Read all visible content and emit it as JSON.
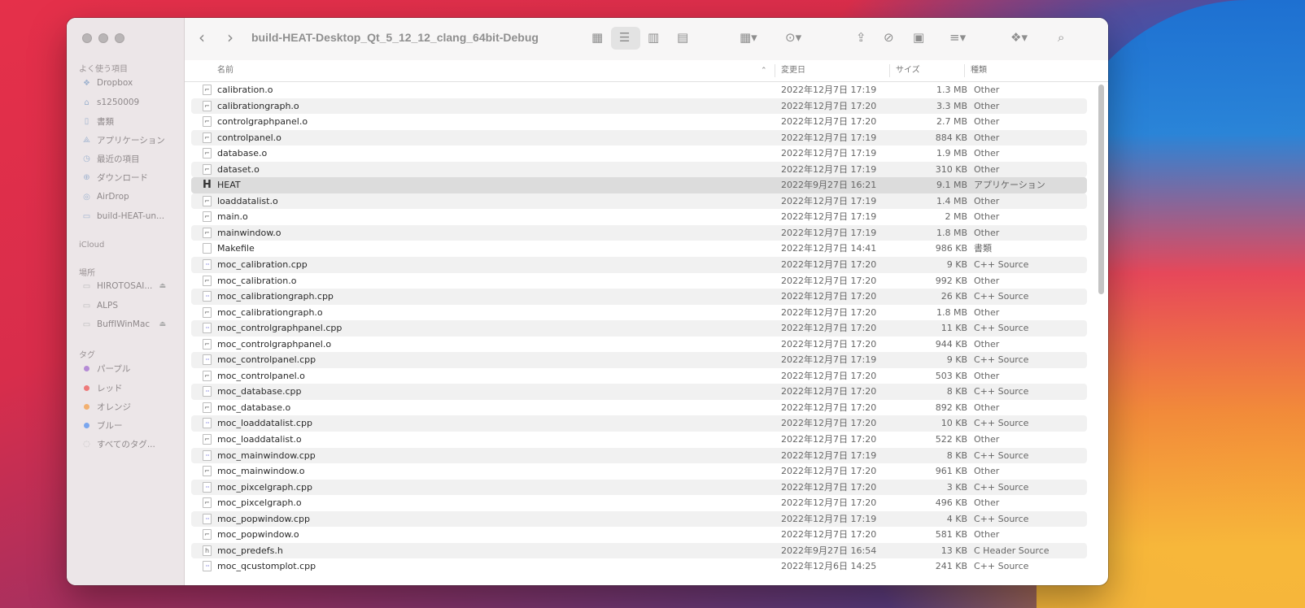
{
  "window": {
    "title": "build-HEAT-Desktop_Qt_5_12_12_clang_64bit-Debug"
  },
  "sidebar": {
    "favorites_heading": "よく使う項目",
    "favorites": [
      {
        "label": "Dropbox",
        "icon": "dropbox-icon"
      },
      {
        "label": "s1250009",
        "icon": "home-icon"
      },
      {
        "label": "書類",
        "icon": "document-icon"
      },
      {
        "label": "アプリケーション",
        "icon": "applications-icon"
      },
      {
        "label": "最近の項目",
        "icon": "clock-icon"
      },
      {
        "label": "ダウンロード",
        "icon": "download-icon"
      },
      {
        "label": "AirDrop",
        "icon": "airdrop-icon"
      },
      {
        "label": "build-HEAT-un...",
        "icon": "folder-icon"
      }
    ],
    "icloud_heading": "iCloud",
    "locations_heading": "場所",
    "locations": [
      {
        "label": "HIROTOSAI...",
        "icon": "drive-icon"
      },
      {
        "label": "ALPS",
        "icon": "drive-icon"
      },
      {
        "label": "BuffIWinMac",
        "icon": "drive-icon"
      }
    ],
    "tags_heading": "タグ",
    "tags": [
      {
        "label": "パープル",
        "color": "#b58bd6"
      },
      {
        "label": "レッド",
        "color": "#ee7a7a"
      },
      {
        "label": "オレンジ",
        "color": "#f2b070"
      },
      {
        "label": "ブルー",
        "color": "#7aa6ee"
      },
      {
        "label": "すべてのタグ...",
        "color": ""
      }
    ]
  },
  "columns": {
    "name": "名前",
    "date": "変更日",
    "size": "サイズ",
    "kind": "種類"
  },
  "files": [
    {
      "name": "calibration.o",
      "date": "2022年12月7日 17:19",
      "size": "1.3 MB",
      "kind": "Other",
      "icon": "object-file-icon"
    },
    {
      "name": "calibrationgraph.o",
      "date": "2022年12月7日 17:20",
      "size": "3.3 MB",
      "kind": "Other",
      "icon": "object-file-icon"
    },
    {
      "name": "controlgraphpanel.o",
      "date": "2022年12月7日 17:20",
      "size": "2.7 MB",
      "kind": "Other",
      "icon": "object-file-icon"
    },
    {
      "name": "controlpanel.o",
      "date": "2022年12月7日 17:19",
      "size": "884 KB",
      "kind": "Other",
      "icon": "object-file-icon"
    },
    {
      "name": "database.o",
      "date": "2022年12月7日 17:19",
      "size": "1.9 MB",
      "kind": "Other",
      "icon": "object-file-icon"
    },
    {
      "name": "dataset.o",
      "date": "2022年12月7日 17:19",
      "size": "310 KB",
      "kind": "Other",
      "icon": "object-file-icon"
    },
    {
      "name": "HEAT",
      "date": "2022年9月27日 16:21",
      "size": "9.1 MB",
      "kind": "アプリケーション",
      "icon": "application-icon",
      "selected": true
    },
    {
      "name": "loaddatalist.o",
      "date": "2022年12月7日 17:19",
      "size": "1.4 MB",
      "kind": "Other",
      "icon": "object-file-icon"
    },
    {
      "name": "main.o",
      "date": "2022年12月7日 17:19",
      "size": "2 MB",
      "kind": "Other",
      "icon": "object-file-icon"
    },
    {
      "name": "mainwindow.o",
      "date": "2022年12月7日 17:19",
      "size": "1.8 MB",
      "kind": "Other",
      "icon": "object-file-icon"
    },
    {
      "name": "Makefile",
      "date": "2022年12月7日 14:41",
      "size": "986 KB",
      "kind": "書類",
      "icon": "document-icon"
    },
    {
      "name": "moc_calibration.cpp",
      "date": "2022年12月7日 17:20",
      "size": "9 KB",
      "kind": "C++ Source",
      "icon": "source-file-icon"
    },
    {
      "name": "moc_calibration.o",
      "date": "2022年12月7日 17:20",
      "size": "992 KB",
      "kind": "Other",
      "icon": "object-file-icon"
    },
    {
      "name": "moc_calibrationgraph.cpp",
      "date": "2022年12月7日 17:20",
      "size": "26 KB",
      "kind": "C++ Source",
      "icon": "source-file-icon"
    },
    {
      "name": "moc_calibrationgraph.o",
      "date": "2022年12月7日 17:20",
      "size": "1.8 MB",
      "kind": "Other",
      "icon": "object-file-icon"
    },
    {
      "name": "moc_controlgraphpanel.cpp",
      "date": "2022年12月7日 17:20",
      "size": "11 KB",
      "kind": "C++ Source",
      "icon": "source-file-icon"
    },
    {
      "name": "moc_controlgraphpanel.o",
      "date": "2022年12月7日 17:20",
      "size": "944 KB",
      "kind": "Other",
      "icon": "object-file-icon"
    },
    {
      "name": "moc_controlpanel.cpp",
      "date": "2022年12月7日 17:19",
      "size": "9 KB",
      "kind": "C++ Source",
      "icon": "source-file-icon"
    },
    {
      "name": "moc_controlpanel.o",
      "date": "2022年12月7日 17:20",
      "size": "503 KB",
      "kind": "Other",
      "icon": "object-file-icon"
    },
    {
      "name": "moc_database.cpp",
      "date": "2022年12月7日 17:20",
      "size": "8 KB",
      "kind": "C++ Source",
      "icon": "source-file-icon"
    },
    {
      "name": "moc_database.o",
      "date": "2022年12月7日 17:20",
      "size": "892 KB",
      "kind": "Other",
      "icon": "object-file-icon"
    },
    {
      "name": "moc_loaddatalist.cpp",
      "date": "2022年12月7日 17:20",
      "size": "10 KB",
      "kind": "C++ Source",
      "icon": "source-file-icon"
    },
    {
      "name": "moc_loaddatalist.o",
      "date": "2022年12月7日 17:20",
      "size": "522 KB",
      "kind": "Other",
      "icon": "object-file-icon"
    },
    {
      "name": "moc_mainwindow.cpp",
      "date": "2022年12月7日 17:19",
      "size": "8 KB",
      "kind": "C++ Source",
      "icon": "source-file-icon"
    },
    {
      "name": "moc_mainwindow.o",
      "date": "2022年12月7日 17:20",
      "size": "961 KB",
      "kind": "Other",
      "icon": "object-file-icon"
    },
    {
      "name": "moc_pixcelgraph.cpp",
      "date": "2022年12月7日 17:20",
      "size": "3 KB",
      "kind": "C++ Source",
      "icon": "source-file-icon"
    },
    {
      "name": "moc_pixcelgraph.o",
      "date": "2022年12月7日 17:20",
      "size": "496 KB",
      "kind": "Other",
      "icon": "object-file-icon"
    },
    {
      "name": "moc_popwindow.cpp",
      "date": "2022年12月7日 17:19",
      "size": "4 KB",
      "kind": "C++ Source",
      "icon": "source-file-icon"
    },
    {
      "name": "moc_popwindow.o",
      "date": "2022年12月7日 17:20",
      "size": "581 KB",
      "kind": "Other",
      "icon": "object-file-icon"
    },
    {
      "name": "moc_predefs.h",
      "date": "2022年9月27日 16:54",
      "size": "13 KB",
      "kind": "C Header Source",
      "icon": "header-file-icon"
    },
    {
      "name": "moc_qcustomplot.cpp",
      "date": "2022年12月6日 14:25",
      "size": "241 KB",
      "kind": "C++ Source",
      "icon": "source-file-icon"
    }
  ]
}
